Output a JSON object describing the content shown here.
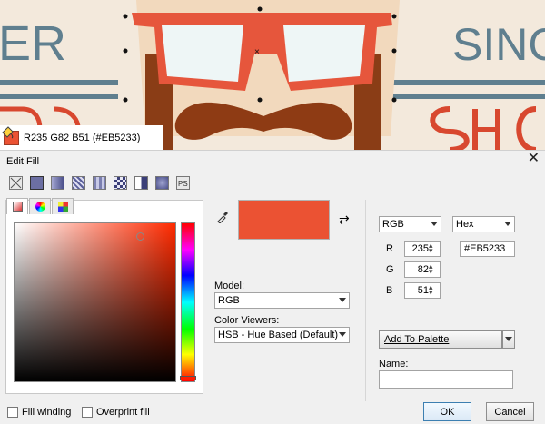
{
  "colors": {
    "fill": "#EB5233",
    "accent": "#3c7fb1"
  },
  "status": {
    "text": "R235 G82 B51 (#EB5233)"
  },
  "canvas": {
    "text_left": "ER",
    "text_right": "SINCE"
  },
  "dialog": {
    "title": "Edit Fill",
    "close_icon": "close-icon",
    "fill_types": [
      "no-fill-icon",
      "uniform-fill-icon",
      "fountain-fill-icon",
      "vector-pattern-icon",
      "bitmap-pattern-icon",
      "two-color-pattern-icon",
      "texture-fill-icon",
      "postscript-fill-icon"
    ],
    "tabs": [
      "color-viewers-tab-icon",
      "color-harmonies-tab-icon",
      "color-palettes-tab-icon"
    ],
    "model_label": "Model:",
    "model_value": "RGB",
    "viewers_label": "Color Viewers:",
    "viewers_value": "HSB - Hue Based (Default)",
    "color_model": "RGB",
    "code_format": "Hex",
    "components": [
      {
        "key": "R",
        "value": "235"
      },
      {
        "key": "G",
        "value": "82"
      },
      {
        "key": "B",
        "value": "51"
      }
    ],
    "hex_value": "#EB5233",
    "add_palette": "Add To Palette",
    "name_label": "Name:",
    "fill_winding": "Fill winding",
    "overprint_fill": "Overprint fill",
    "ok": "OK",
    "cancel": "Cancel"
  }
}
